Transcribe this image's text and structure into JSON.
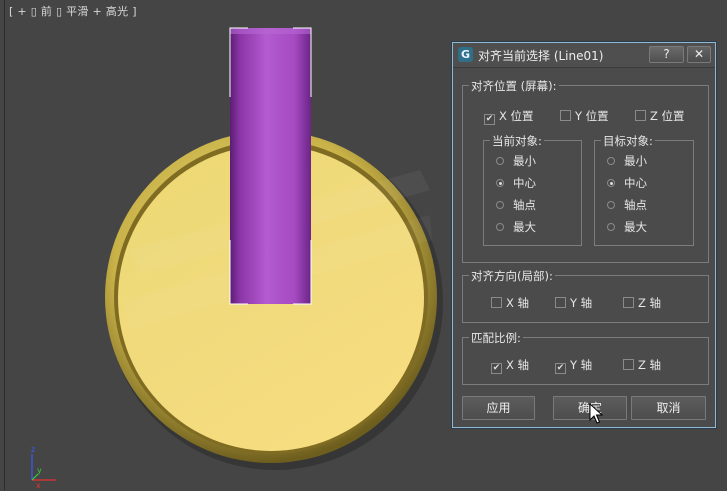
{
  "viewport": {
    "label": "[ + ▯ 前 ▯ 平滑 + 高光 ]",
    "colors": {
      "background": "#454545",
      "disc_gold": "#d9c96a",
      "rod_purple": "#a84fc6"
    },
    "axis_labels": {
      "z": "z",
      "y": "y",
      "x": "x"
    }
  },
  "dialog": {
    "title": "对齐当前选择 (Line01)",
    "help_label": "?",
    "close_label": "✕",
    "align_position": {
      "legend": "对齐位置 (屏幕):",
      "x": {
        "label": "X 位置",
        "checked": true,
        "mark": "✔"
      },
      "y": {
        "label": "Y 位置",
        "checked": false,
        "mark": ""
      },
      "z": {
        "label": "Z 位置",
        "checked": false,
        "mark": ""
      },
      "current_object": {
        "legend": "当前对象:",
        "options": [
          "最小",
          "中心",
          "轴点",
          "最大"
        ],
        "selected": "中心"
      },
      "target_object": {
        "legend": "目标对象:",
        "options": [
          "最小",
          "中心",
          "轴点",
          "最大"
        ],
        "selected": "中心"
      }
    },
    "align_orientation": {
      "legend": "对齐方向(局部):",
      "x": {
        "label": "X 轴",
        "checked": false,
        "mark": ""
      },
      "y": {
        "label": "Y 轴",
        "checked": false,
        "mark": ""
      },
      "z": {
        "label": "Z 轴",
        "checked": false,
        "mark": ""
      }
    },
    "match_scale": {
      "legend": "匹配比例:",
      "x": {
        "label": "X 轴",
        "checked": true,
        "mark": "✔"
      },
      "y": {
        "label": "Y 轴",
        "checked": true,
        "mark": "✔"
      },
      "z": {
        "label": "Z 轴",
        "checked": false,
        "mark": ""
      }
    },
    "buttons": {
      "apply": "应用",
      "ok": "确定",
      "cancel": "取消"
    }
  }
}
